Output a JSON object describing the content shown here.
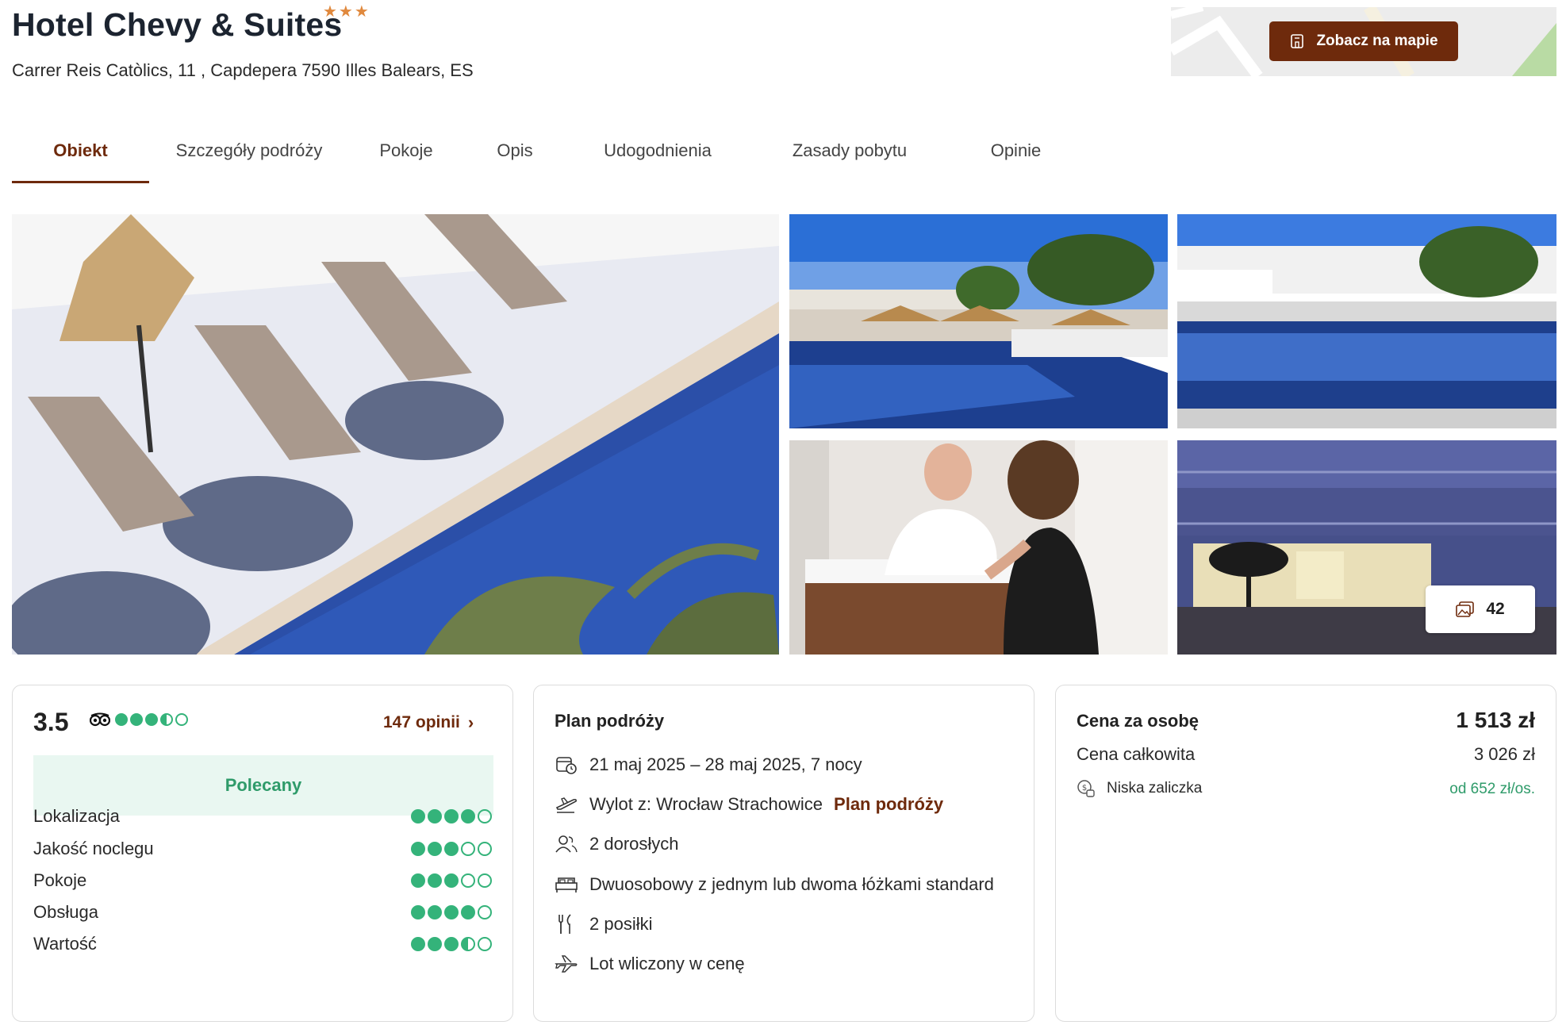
{
  "hotel": {
    "name": "Hotel Chevy & Suites",
    "stars": "★★★",
    "address": "Carrer Reis Catòlics, 11 , Capdepera 7590 Illes Balears, ES"
  },
  "map": {
    "button_label": "Zobacz na mapie"
  },
  "tabs": [
    {
      "label": "Obiekt",
      "active": true
    },
    {
      "label": "Szczegóły podróży"
    },
    {
      "label": "Pokoje"
    },
    {
      "label": "Opis"
    },
    {
      "label": "Udogodnienia"
    },
    {
      "label": "Zasady pobytu"
    },
    {
      "label": "Opinie"
    }
  ],
  "gallery": {
    "photo_count": "42"
  },
  "rating": {
    "score": "3.5",
    "tripadvisor_dots": 3.5,
    "reviews_link": "147 opinii",
    "badge": "Polecany",
    "categories": [
      {
        "label": "Lokalizacja",
        "dots": 4
      },
      {
        "label": "Jakość noclegu",
        "dots": 3
      },
      {
        "label": "Pokoje",
        "dots": 3
      },
      {
        "label": "Obsługa",
        "dots": 4
      },
      {
        "label": "Wartość",
        "dots": 3.5
      }
    ]
  },
  "plan": {
    "title": "Plan podróży",
    "dates": "21 maj 2025 – 28 maj 2025, 7 nocy",
    "departure": "Wylot z: Wrocław Strachowice",
    "plan_link": "Plan podróży",
    "guests": "2 dorosłych",
    "room": "Dwuosobowy z jednym lub dwoma łóżkami standard",
    "meals": "2 posiłki",
    "flight": "Lot wliczony w cenę"
  },
  "price": {
    "per_person_label": "Cena za osobę",
    "per_person_value": "1 513 zł",
    "total_label": "Cena całkowita",
    "total_value": "3 026 zł",
    "deposit_label": "Niska zaliczka",
    "deposit_value": "od 652 zł/os."
  },
  "colors": {
    "brand": "#6e2a0c",
    "green": "#34b37a",
    "stars": "#e0893e"
  }
}
